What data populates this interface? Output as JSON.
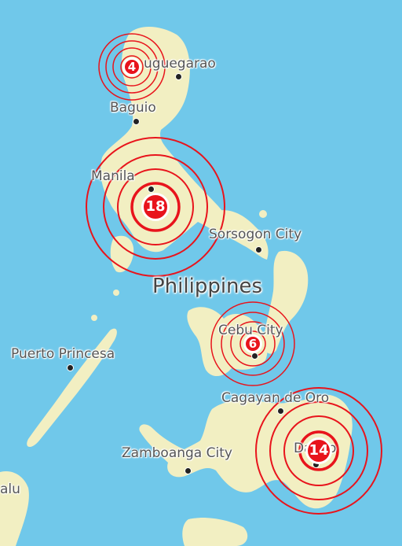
{
  "map": {
    "country": "Philippines",
    "cities": [
      {
        "name": "Tuguegarao",
        "visible_text": "uguegarao"
      },
      {
        "name": "Baguio",
        "visible_text": "Baguio"
      },
      {
        "name": "Manila",
        "visible_text": "Manila"
      },
      {
        "name": "Sorsogon City",
        "visible_text": "Sorsogon City"
      },
      {
        "name": "Cebu City",
        "visible_text": "Cebu City"
      },
      {
        "name": "Puerto Princesa",
        "visible_text": "Puerto Princesa"
      },
      {
        "name": "Cagayan de Oro",
        "visible_text": "Cagayan de Oro"
      },
      {
        "name": "Zamboanga City",
        "visible_text": "Zamboanga City"
      },
      {
        "name": "Davao",
        "visible_text": "Davao"
      },
      {
        "name": "Palu",
        "visible_text": "alu"
      }
    ],
    "clusters": [
      {
        "label": "4",
        "near": "Tuguegarao"
      },
      {
        "label": "18",
        "near": "Manila"
      },
      {
        "label": "6",
        "near": "Cebu City"
      },
      {
        "label": "14",
        "near": "Davao"
      }
    ],
    "colors": {
      "water": "#70c8ea",
      "land": "#f2efc2",
      "marker": "#e8141c"
    }
  }
}
